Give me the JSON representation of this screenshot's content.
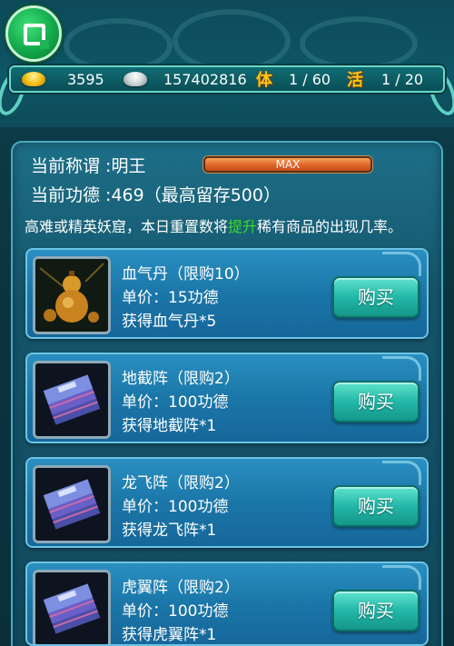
{
  "header": {
    "gold": "3595",
    "silver": "157402816",
    "stamina_glyph": "体",
    "stamina": "1 / 60",
    "activity_glyph": "活",
    "activity": "1 / 20"
  },
  "info": {
    "title_label": "当前称谓 :",
    "title_value": "明王",
    "progress_text": "MAX",
    "merit_label": "当前功德 :",
    "merit_value": "469（最高留存500）",
    "desc_pre": "高难或精英妖窟，本日重置数将",
    "desc_highlight": "提升",
    "desc_post": "稀有商品的出现几率。"
  },
  "items": [
    {
      "title": "血气丹（限购10）",
      "price": "单价：15功德",
      "gain": "获得血气丹*5",
      "buy": "购买"
    },
    {
      "title": "地截阵（限购2）",
      "price": "单价：100功德",
      "gain": "获得地截阵*1",
      "buy": "购买"
    },
    {
      "title": "龙飞阵（限购2）",
      "price": "单价：100功德",
      "gain": "获得龙飞阵*1",
      "buy": "购买"
    },
    {
      "title": "虎翼阵（限购2）",
      "price": "单价：100功德",
      "gain": "获得虎翼阵*1",
      "buy": "购买"
    }
  ],
  "icons": {
    "back": "back-square-icon",
    "gold": "gold-ingot-icon",
    "silver": "silver-ingot-icon",
    "item1": "gourd-icon",
    "item_scroll": "scroll-book-icon"
  },
  "colors": {
    "highlight": "#35e01c",
    "buy_button": "#23b8a8",
    "progress": "#e0652a"
  }
}
